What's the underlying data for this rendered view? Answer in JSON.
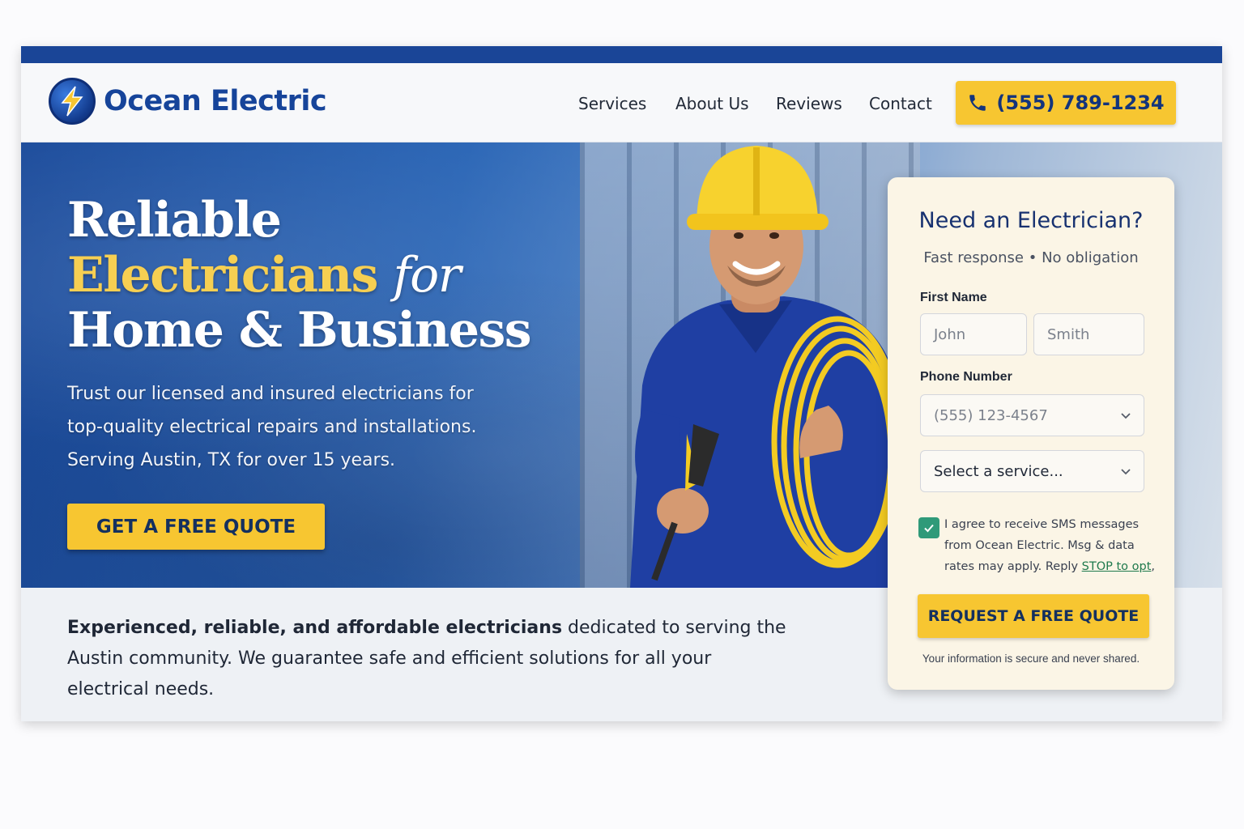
{
  "brand": {
    "name": "Ocean Electric"
  },
  "nav": {
    "items": [
      "Services",
      "About Us",
      "Reviews",
      "Contact"
    ],
    "phone": "(555) 789-1234"
  },
  "hero": {
    "line1": "Reliable",
    "line2_highlight": "Electricians",
    "line2_rest": "for",
    "line3": "Home & Business",
    "subtitle_lines": [
      "Trust our licensed and insured electricians for",
      "top-quality electrical repairs and installations.",
      "Serving Austin, TX for over 15 years."
    ],
    "cta": "GET A FREE QUOTE"
  },
  "intro": {
    "bold": "Experienced, reliable, and affordable electricians",
    "rest": " dedicated to serving the Austin community. We guarantee safe and efficient solutions for all your electrical needs."
  },
  "form": {
    "title": "Need an Electrician?",
    "subtitle": "Fast response • No obligation",
    "first_name_label": "First Name",
    "first_name_placeholder": "John",
    "last_name_placeholder": "Smith",
    "phone_label": "Phone Number",
    "phone_placeholder": "(555) 123-4567",
    "service_select": "Select a service...",
    "consent_checked": true,
    "consent_text": "I agree to receive SMS messages from Ocean Electric. Msg & data rates may apply. Reply ",
    "consent_link": "STOP to opt",
    "consent_tail": ",",
    "submit": "REQUEST A FREE QUOTE",
    "secure_note": "Your information is secure and never shared."
  },
  "colors": {
    "brand_blue": "#16449a",
    "accent_yellow": "#f7c631",
    "form_bg": "#fbf5e6",
    "check_green": "#2f9a79"
  }
}
